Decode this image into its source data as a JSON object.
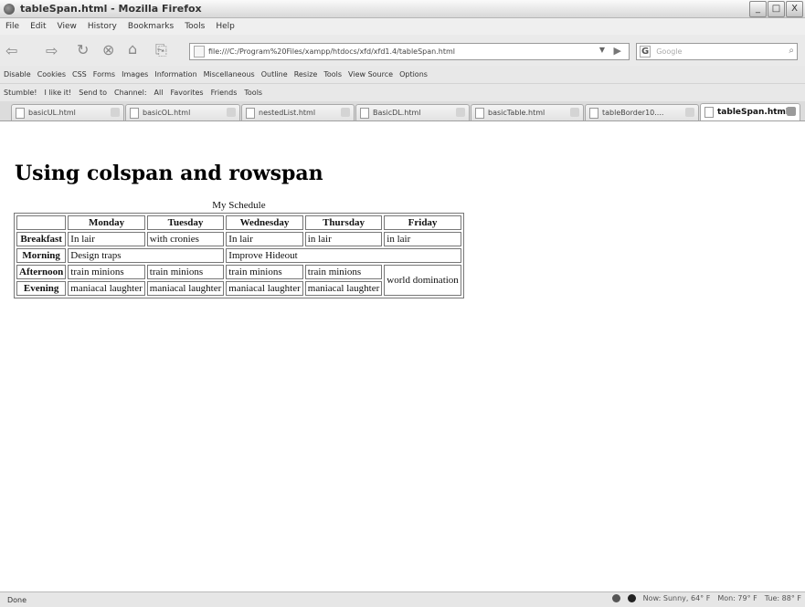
{
  "window": {
    "title": "tableSpan.html - Mozilla Firefox",
    "controls": [
      "_",
      "□",
      "X"
    ]
  },
  "menu": [
    "File",
    "Edit",
    "View",
    "History",
    "Bookmarks",
    "Tools",
    "Help"
  ],
  "nav": {
    "url": "file:///C:/Program%20Files/xampp/htdocs/xfd/xfd1.4/tableSpan.html",
    "search_placeholder": "Google",
    "search_engine": "G"
  },
  "webdev_toolbar": [
    "Disable",
    "Cookies",
    "CSS",
    "Forms",
    "Images",
    "Information",
    "Miscellaneous",
    "Outline",
    "Resize",
    "Tools",
    "View Source",
    "Options"
  ],
  "stumble_toolbar": [
    "Stumble!",
    "I like it!",
    "Send to",
    "Channel:",
    "All",
    "Favorites",
    "Friends",
    "Tools"
  ],
  "tabs": [
    {
      "label": "basicUL.html"
    },
    {
      "label": "basicOL.html"
    },
    {
      "label": "nestedList.html"
    },
    {
      "label": "BasicDL.html"
    },
    {
      "label": "basicTable.html"
    },
    {
      "label": "tableBorder10...."
    },
    {
      "label": "tableSpan.html",
      "active": true
    }
  ],
  "page": {
    "heading": "Using colspan and rowspan",
    "table": {
      "caption": "My Schedule",
      "headers": [
        "",
        "Monday",
        "Tuesday",
        "Wednesday",
        "Thursday",
        "Friday"
      ],
      "rows": {
        "breakfast": {
          "label": "Breakfast",
          "cells": [
            "In lair",
            "with cronies",
            "In lair",
            "in lair",
            "in lair"
          ]
        },
        "morning": {
          "label": "Morning",
          "design": "Design traps",
          "hideout": "Improve Hideout"
        },
        "afternoon": {
          "label": "Afternoon",
          "cells": [
            "train minions",
            "train minions",
            "train minions",
            "train minions"
          ],
          "friday": "world domination"
        },
        "evening": {
          "label": "Evening",
          "cells": [
            "maniacal laughter",
            "maniacal laughter",
            "maniacal laughter",
            "maniacal laughter"
          ]
        }
      }
    }
  },
  "status": {
    "text": "Done",
    "weather_now": "Now: Sunny, 64° F",
    "mon": "Mon: 79° F",
    "tue": "Tue: 88° F"
  }
}
